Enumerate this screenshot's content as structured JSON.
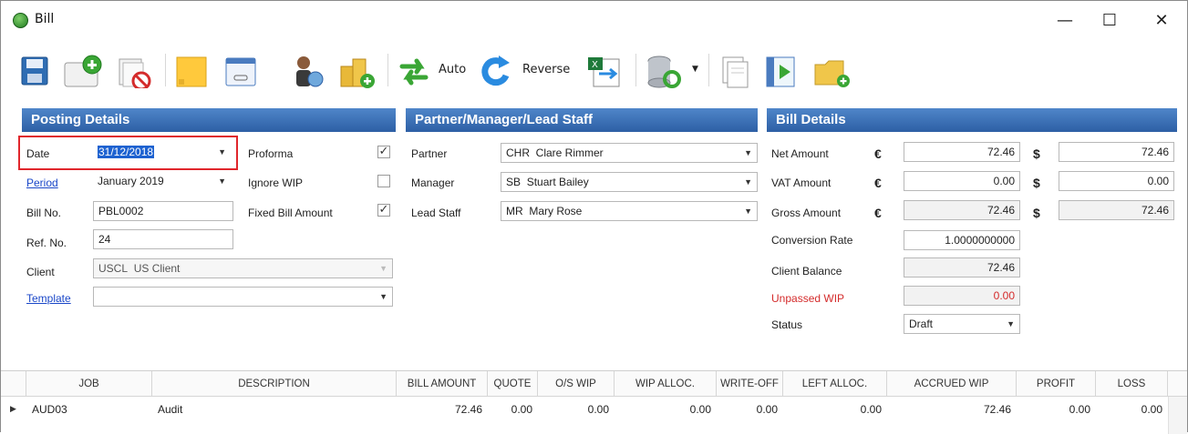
{
  "window": {
    "title": "Bill"
  },
  "toolbar": {
    "auto_label": "Auto",
    "reverse_label": "Reverse"
  },
  "posting": {
    "heading": "Posting Details",
    "date_label": "Date",
    "date_value": "31/12/2018",
    "period_label": "Period",
    "period_value": "January 2019",
    "billno_label": "Bill No.",
    "billno_value": "PBL0002",
    "refno_label": "Ref. No.",
    "refno_value": "24",
    "client_label": "Client",
    "client_code": "USCL",
    "client_name": "US Client",
    "template_label": "Template",
    "template_value": "",
    "proforma_label": "Proforma",
    "proforma_checked": true,
    "ignorewip_label": "Ignore WIP",
    "ignorewip_checked": false,
    "fixedbill_label": "Fixed Bill Amount",
    "fixedbill_checked": true
  },
  "staff": {
    "heading": "Partner/Manager/Lead Staff",
    "partner_label": "Partner",
    "partner_code": "CHR",
    "partner_name": "Clare Rimmer",
    "manager_label": "Manager",
    "manager_code": "SB",
    "manager_name": "Stuart Bailey",
    "lead_label": "Lead Staff",
    "lead_code": "MR",
    "lead_name": "Mary Rose"
  },
  "bill": {
    "heading": "Bill Details",
    "euro_symbol": "€",
    "dollar_symbol": "$",
    "net_label": "Net Amount",
    "net_eur": "72.46",
    "net_usd": "72.46",
    "vat_label": "VAT Amount",
    "vat_eur": "0.00",
    "vat_usd": "0.00",
    "gross_label": "Gross Amount",
    "gross_eur": "72.46",
    "gross_usd": "72.46",
    "conv_label": "Conversion Rate",
    "conv_value": "1.0000000000",
    "balance_label": "Client Balance",
    "balance_value": "72.46",
    "unpassed_label": "Unpassed WIP",
    "unpassed_value": "0.00",
    "status_label": "Status",
    "status_value": "Draft"
  },
  "grid": {
    "columns": [
      "JOB",
      "DESCRIPTION",
      "BILL AMOUNT",
      "QUOTE",
      "O/S WIP",
      "WIP ALLOC.",
      "WRITE-OFF",
      "LEFT ALLOC.",
      "ACCRUED WIP",
      "PROFIT",
      "LOSS"
    ],
    "rows": [
      [
        "AUD03",
        "Audit",
        "72.46",
        "0.00",
        "0.00",
        "0.00",
        "0.00",
        "0.00",
        "72.46",
        "0.00",
        "0.00"
      ]
    ]
  },
  "colors": {
    "panel_header": "#2d5fa5",
    "highlight": "#e0262c",
    "link": "#1a47c8",
    "warning_text": "#d42b2b"
  }
}
